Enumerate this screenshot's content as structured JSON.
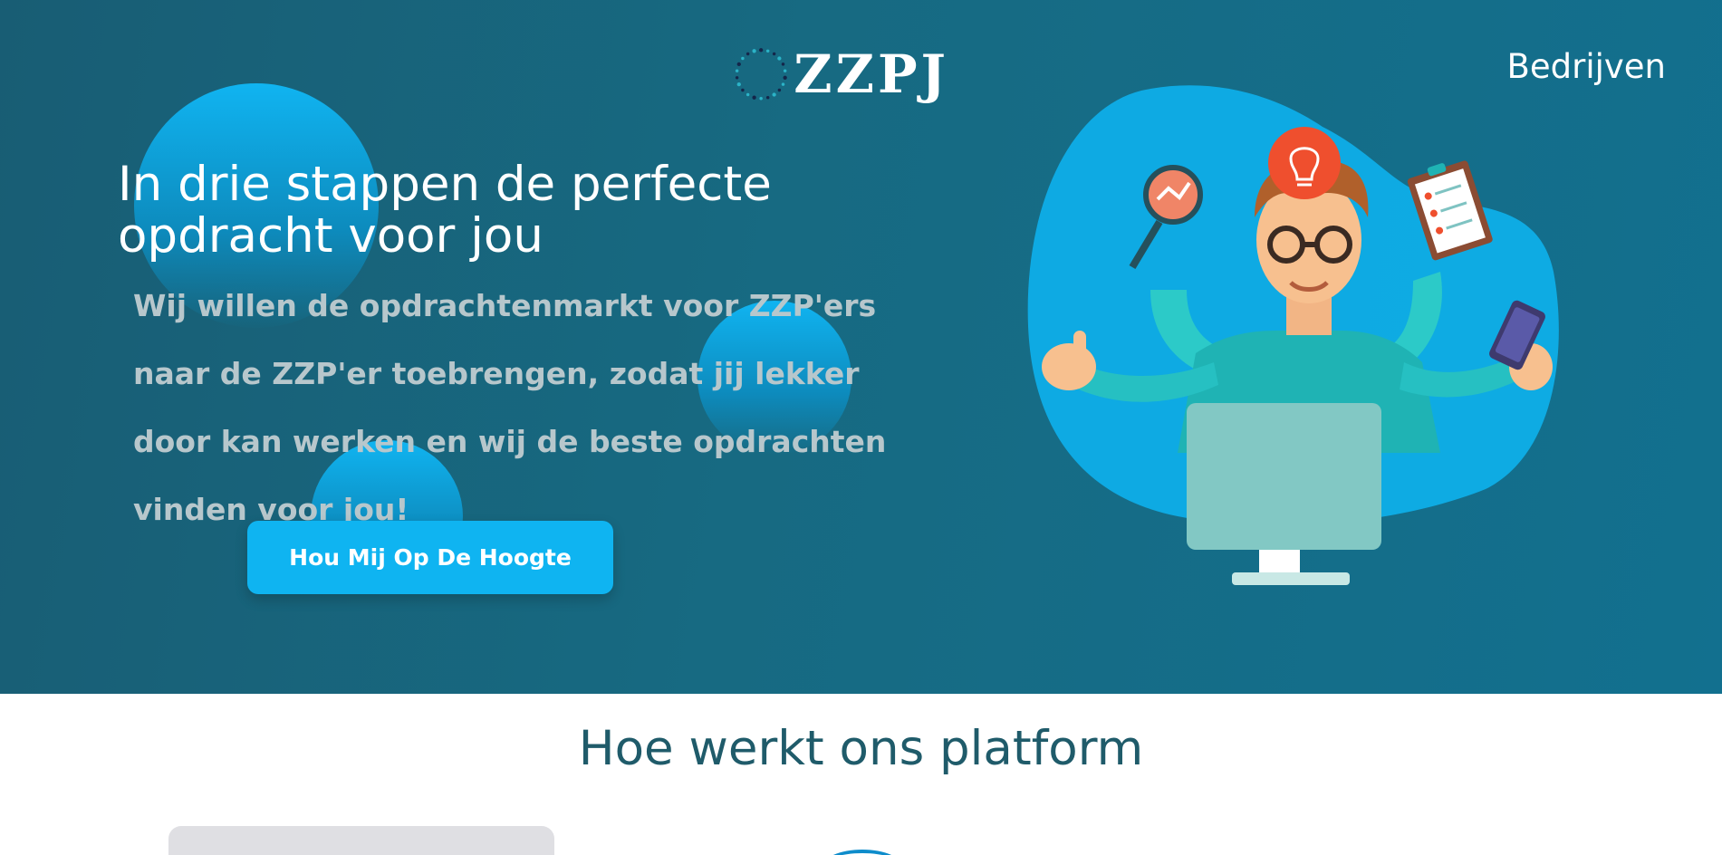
{
  "brand": {
    "logo_text": "ZZPJ"
  },
  "nav": {
    "companies_label": "Bedrijven"
  },
  "hero": {
    "headline": "In drie stappen de perfecte opdracht voor jou",
    "subtext": "Wij willen de opdrachtenmarkt voor ZZP'ers naar de ZZP'er toebrengen, zodat jij lekker door kan werken en wij de beste opdrachten vinden voor jou!",
    "cta_label": "Hou Mij Op De Hoogte"
  },
  "how_it_works": {
    "title": "Hoe werkt ons platform"
  },
  "colors": {
    "hero_bg": "#176a82",
    "accent": "#0fb4f1",
    "title": "#1f5b6a"
  },
  "icons": [
    "logo-ring-icon",
    "magnifier-icon",
    "lightbulb-icon",
    "clipboard-icon",
    "phone-icon",
    "computer-icon"
  ]
}
